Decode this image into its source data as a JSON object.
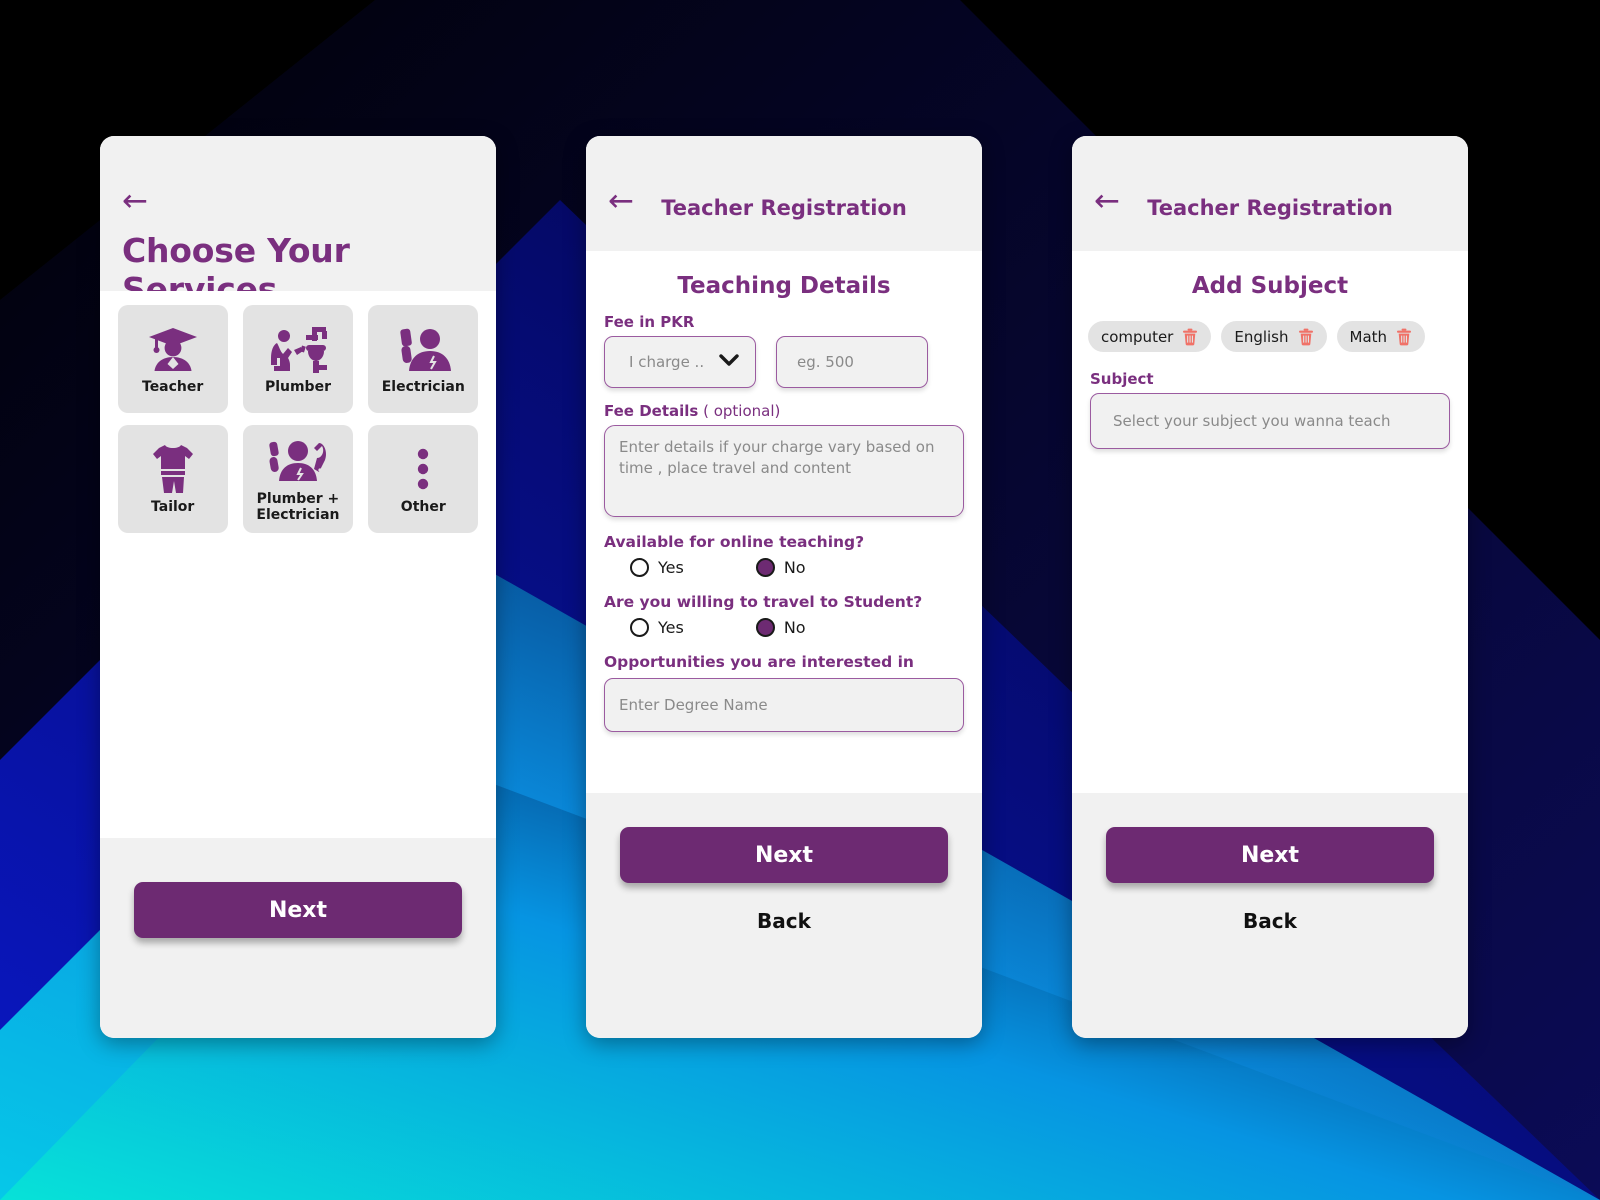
{
  "theme": {
    "purple": "#7a2f7f",
    "purple_deep": "#6d2a72",
    "chip_bg": "#e3e3e3",
    "panel_bg": "#f1f1f1",
    "trash_red": "#F07268"
  },
  "background": {
    "bands": [
      {
        "name": "band-black",
        "color": "#000000"
      },
      {
        "name": "band-navy",
        "color": "#06064a"
      },
      {
        "name": "band-blue",
        "color": "#0a18c8"
      },
      {
        "name": "band-azure",
        "color": "#0a8ee0"
      },
      {
        "name": "band-cyan",
        "color": "#07e2d8"
      }
    ]
  },
  "phone1": {
    "back_icon": "arrow-left-icon",
    "title": "Choose Your Services",
    "services": [
      {
        "label": "Teacher",
        "icon": "graduation-person-icon"
      },
      {
        "label": "Plumber",
        "icon": "plumber-icon"
      },
      {
        "label": "Electrician",
        "icon": "electrician-icon"
      },
      {
        "label": "Tailor",
        "icon": "clothes-icon"
      },
      {
        "label": "Plumber +\nElectrician",
        "icon": "plumber-electrician-icon"
      },
      {
        "label": "Other",
        "icon": "three-dots-icon"
      }
    ],
    "next_label": "Next"
  },
  "phone2": {
    "back_icon": "arrow-left-icon",
    "appbar_title": "Teacher Registration",
    "section_title": "Teaching Details",
    "fee_label": "Fee in PKR",
    "fee_select_value": "I charge ..",
    "fee_select_chevron": "chevron-down-icon",
    "fee_amount_placeholder": "eg. 500",
    "fee_details_label": "Fee Details",
    "fee_details_optional": " ( optional)",
    "fee_details_placeholder": "Enter details if your charge vary based on time , place  travel and content",
    "q_online_label": "Available for online teaching?",
    "q_online_yes": "Yes",
    "q_online_no": "No",
    "q_online_selected": "No",
    "q_travel_label": "Are you willing to travel to Student?",
    "q_travel_yes": "Yes",
    "q_travel_no": "No",
    "q_travel_selected": "No",
    "opportunities_label": "Opportunities you are interested in",
    "degree_placeholder": "Enter Degree Name",
    "next_label": "Next",
    "back_label": "Back"
  },
  "phone3": {
    "back_icon": "arrow-left-icon",
    "appbar_title": "Teacher Registration",
    "section_title": "Add Subject",
    "chips": [
      {
        "label": "computer",
        "delete_icon": "trash-icon"
      },
      {
        "label": "English",
        "delete_icon": "trash-icon"
      },
      {
        "label": "Math",
        "delete_icon": "trash-icon"
      }
    ],
    "subject_label": "Subject",
    "subject_placeholder": "Select your subject you wanna teach",
    "next_label": "Next",
    "back_label": "Back"
  }
}
